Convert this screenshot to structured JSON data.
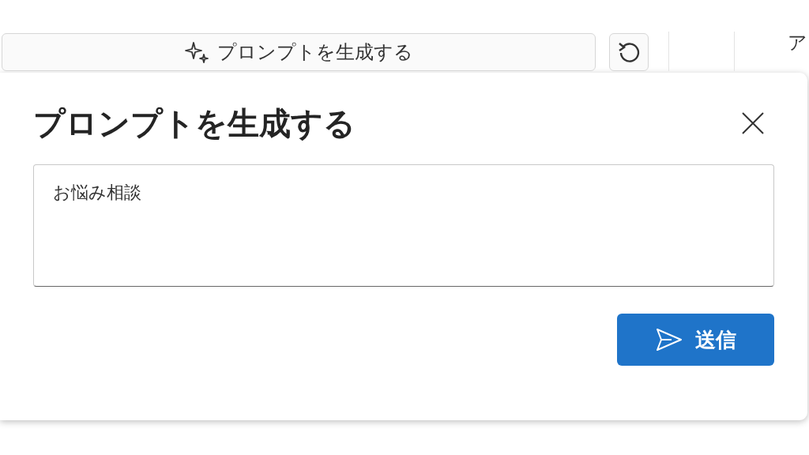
{
  "toolbar": {
    "generate_button": {
      "label": "プロンプトを生成する"
    },
    "right_panel_text": "ア"
  },
  "dialog": {
    "title": "プロンプトを生成する",
    "prompt": {
      "value": "お悩み相談"
    },
    "send_button": {
      "label": "送信"
    }
  }
}
